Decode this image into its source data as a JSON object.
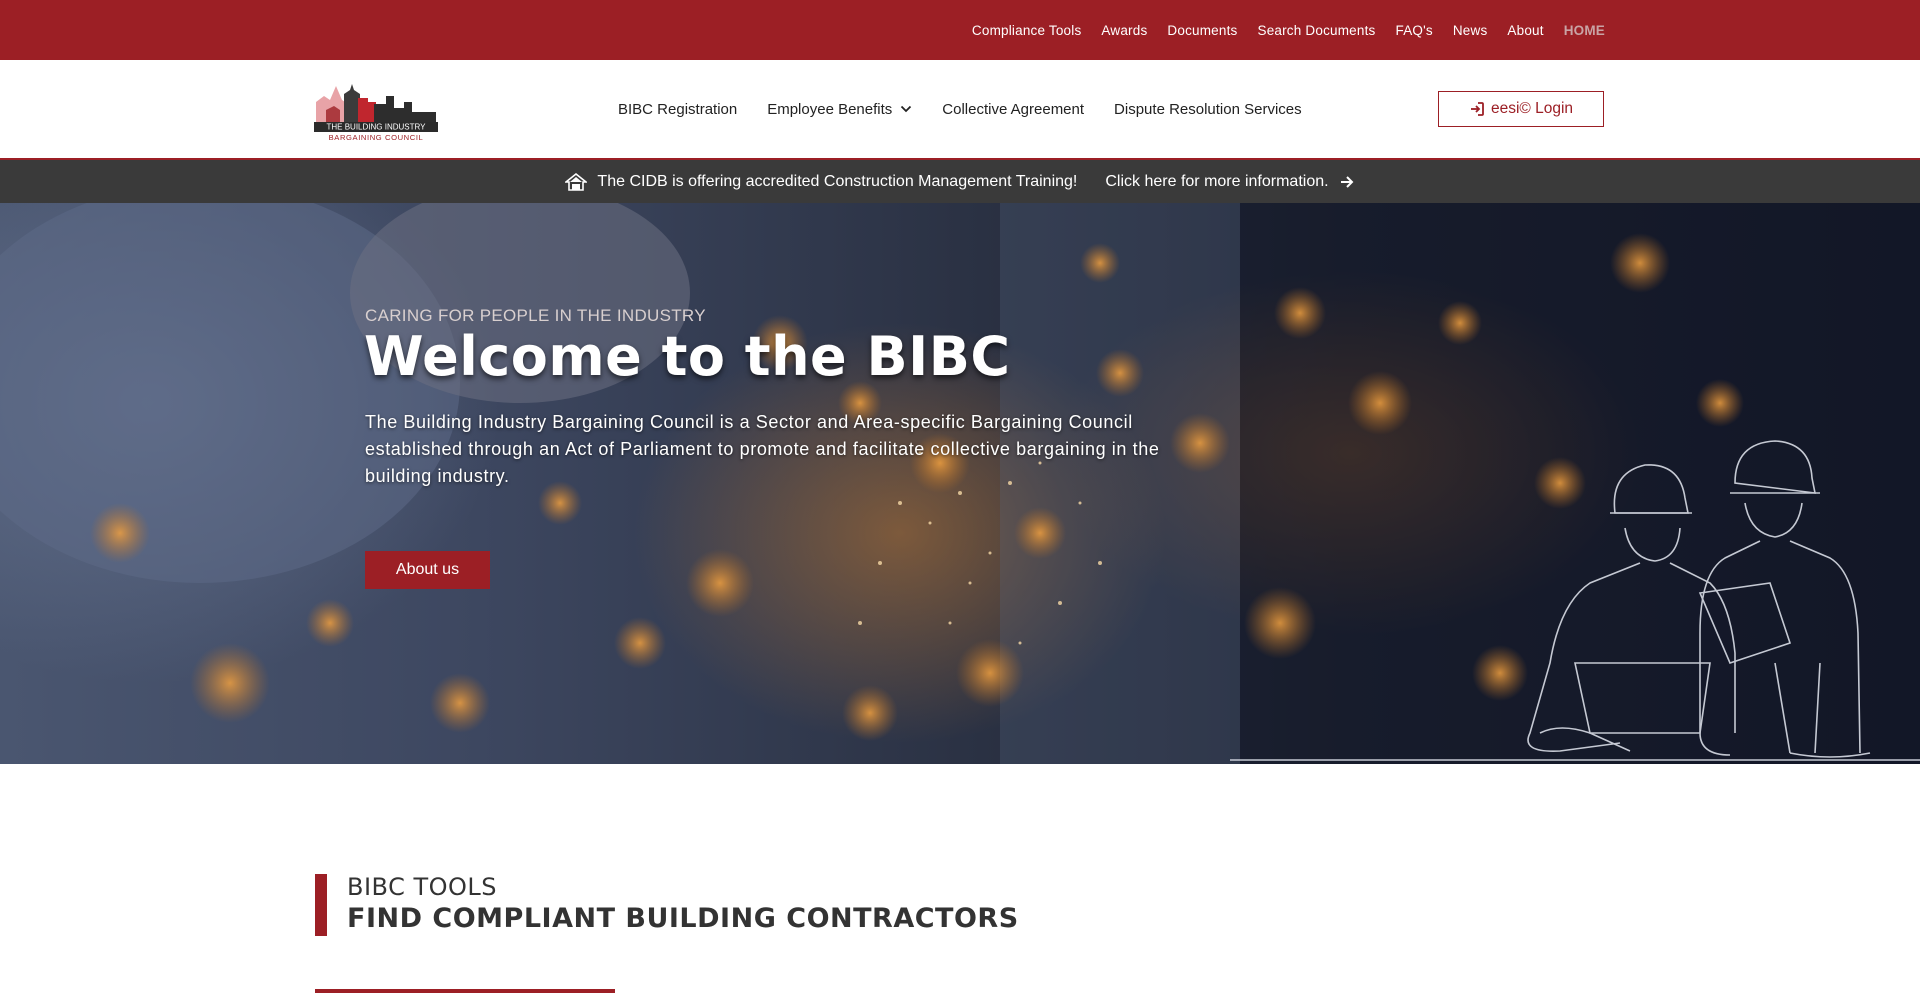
{
  "topnav": {
    "items": [
      {
        "label": "Compliance Tools"
      },
      {
        "label": "Awards"
      },
      {
        "label": "Documents"
      },
      {
        "label": "Search Documents"
      },
      {
        "label": "FAQ's"
      },
      {
        "label": "News"
      },
      {
        "label": "About"
      },
      {
        "label": "HOME"
      }
    ]
  },
  "header": {
    "logo": {
      "line1": "THE BUILDING INDUSTRY",
      "line2": "BARGAINING COUNCIL"
    },
    "nav": [
      {
        "label": "BIBC Registration"
      },
      {
        "label": "Employee Benefits"
      },
      {
        "label": "Collective Agreement"
      },
      {
        "label": "Dispute Resolution Services"
      }
    ],
    "login_label": "eesi© Login"
  },
  "announcement": {
    "text": "The CIDB is offering accredited Construction Management Training!",
    "link": "Click here for more information."
  },
  "hero": {
    "kicker": "CARING FOR PEOPLE IN THE INDUSTRY",
    "title": "Welcome to the BIBC",
    "description": "The Building Industry Bargaining Council is a Sector and Area-specific Bargaining Council established through an Act of Parliament to promote and facilitate collective bargaining in the building industry.",
    "button": "About us"
  },
  "tools": {
    "kicker": "BIBC TOOLS",
    "title": "FIND COMPLIANT BUILDING CONTRACTORS"
  },
  "colors": {
    "brand_red": "#9c1f25",
    "announce_bg": "#3a3a3a"
  },
  "icons": [
    "sign-in-icon",
    "chevron-down-icon",
    "house-icon",
    "arrow-right-icon"
  ]
}
